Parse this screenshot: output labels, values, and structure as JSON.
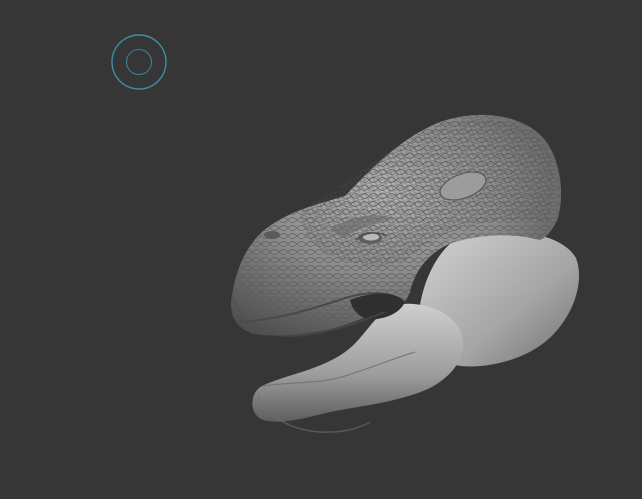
{
  "canvas": {
    "background": "#363636"
  },
  "brush_cursor": {
    "icon": "brush-circle-cursor",
    "color": "#3f8fa3"
  },
  "model": {
    "icon": "sculpted-creature-head",
    "material_color": "#8f8f8f"
  }
}
